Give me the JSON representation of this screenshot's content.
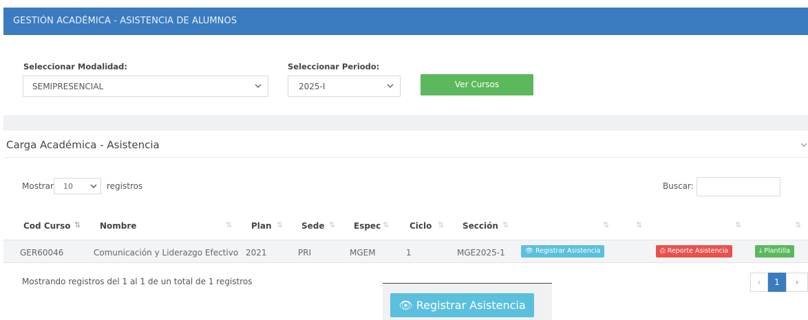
{
  "header": {
    "title": "GESTIÓN ACADÉMICA - ASISTENCIA DE ALUMNOS"
  },
  "filters": {
    "modalidad_label": "Seleccionar Modalidad:",
    "modalidad_value": "SEMIPRESENCIAL",
    "periodo_label": "Seleccionar Periodo:",
    "periodo_value": "2025-I",
    "ver_cursos_label": "Ver Cursos"
  },
  "panel": {
    "title": "Carga Académica - Asistencia"
  },
  "table_controls": {
    "mostrar_label": "Mostrar",
    "page_size": "10",
    "registros_label": "registros",
    "buscar_label": "Buscar:"
  },
  "table": {
    "columns": [
      "Cod Curso",
      "Nombre",
      "Plan",
      "Sede",
      "Espec",
      "Ciclo",
      "Sección"
    ],
    "rows": [
      {
        "cod_curso": "GER60046",
        "nombre": "Comunicación y Liderazgo Efectivo",
        "plan": "2021",
        "sede": "PRI",
        "espec": "MGEM",
        "ciclo": "1",
        "seccion": "MGE2025-1",
        "registrar_label": "Registrar Asistencia",
        "reporte_label": "Reporte Asistencia",
        "plantilla_label": "Plantilla"
      }
    ],
    "info": "Mostrando registros del 1 al 1 de un total de 1 registros"
  },
  "pagination": {
    "prev": "‹",
    "current": "1",
    "next": "›"
  },
  "tooltip": {
    "label": "Registrar Asistencia"
  },
  "colors": {
    "header": "#3b7bbf",
    "success": "#5cb85c",
    "info": "#5bc0de",
    "danger": "#e9514d"
  }
}
